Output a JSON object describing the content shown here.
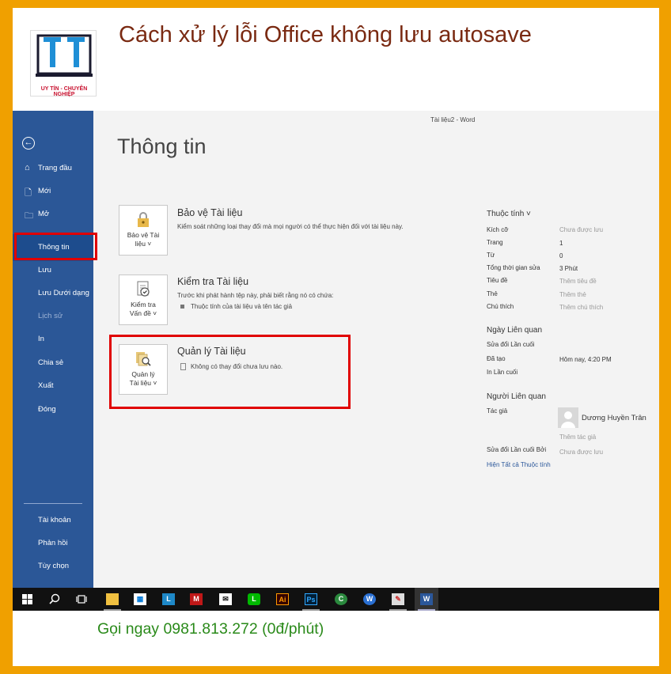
{
  "banner": {
    "title": "Cách xử lý lỗi Office không lưu autosave",
    "logo_tagline": "UY TÍN - CHUYÊN NGHIỆP",
    "call_text": "Gọi ngay 0981.813.272 (0đ/phút)"
  },
  "window": {
    "doc_title": "Tài liệu2 - Word"
  },
  "nav": {
    "items": [
      {
        "label": "Trang đầu",
        "icon": "home-icon"
      },
      {
        "label": "Mới",
        "icon": "new-doc-icon"
      },
      {
        "label": "Mở",
        "icon": "folder-icon"
      },
      {
        "label": "Thông tin"
      },
      {
        "label": "Lưu"
      },
      {
        "label": "Lưu Dưới dạng"
      },
      {
        "label": "Lịch sử"
      },
      {
        "label": "In"
      },
      {
        "label": "Chia sẻ"
      },
      {
        "label": "Xuất"
      },
      {
        "label": "Đóng"
      },
      {
        "label": "Tài khoản"
      },
      {
        "label": "Phản hồi"
      },
      {
        "label": "Tùy chọn"
      }
    ]
  },
  "main": {
    "heading": "Thông tin",
    "sections": [
      {
        "card_line1": "Bảo vệ Tài",
        "card_line2": "liệu ˅",
        "title": "Bảo vệ Tài liệu",
        "desc": "Kiểm soát những loại thay đổi mà mọi người có thể thực hiện đối với tài liệu này."
      },
      {
        "card_line1": "Kiểm tra",
        "card_line2": "Vấn đề ˅",
        "title": "Kiểm tra Tài liệu",
        "desc": "Trước khi phát hành tệp này, phải biết rằng nó có chứa:",
        "bullet": "Thuộc tính của tài liệu và tên tác giả"
      },
      {
        "card_line1": "Quản lý",
        "card_line2": "Tài liệu ˅",
        "title": "Quản lý Tài liệu",
        "bullet": "Không có thay đổi chưa lưu nào."
      }
    ]
  },
  "properties": {
    "header": "Thuộc tính ˅",
    "rows": [
      {
        "key": "Kích cỡ",
        "value": "Chưa được lưu"
      },
      {
        "key": "Trang",
        "value": "1"
      },
      {
        "key": "Từ",
        "value": "0"
      },
      {
        "key": "Tổng thời gian sửa",
        "value": "3 Phút"
      },
      {
        "key": "Tiêu đề",
        "value": "Thêm tiêu đề"
      },
      {
        "key": "Thẻ",
        "value": "Thêm thẻ"
      },
      {
        "key": "Chú thích",
        "value": "Thêm chú thích"
      }
    ],
    "dates_header": "Ngày Liên quan",
    "dates": [
      {
        "key": "Sửa đổi Lần cuối",
        "value": ""
      },
      {
        "key": "Đã tạo",
        "value": "Hôm nay, 4:20 PM"
      },
      {
        "key": "In Lần cuối",
        "value": ""
      }
    ],
    "people_header": "Người Liên quan",
    "author_key": "Tác giả",
    "author_name": "Dương Huyền Trân",
    "add_author": "Thêm tác giả",
    "last_modified_by_key": "Sửa đổi Lần cuối Bởi",
    "last_modified_by_value": "Chưa được lưu",
    "show_all_link": "Hiện Tất cả Thuộc tính"
  },
  "taskbar": {
    "apps": [
      "windows-start-icon",
      "search-icon",
      "task-view-icon",
      "file-explorer-icon",
      "store-icon",
      "lingoes-icon",
      "mcafee-icon",
      "mail-icon",
      "line-icon",
      "illustrator-icon",
      "photoshop-icon",
      "corel-icon",
      "wps-icon",
      "paint-icon",
      "word-icon"
    ]
  }
}
